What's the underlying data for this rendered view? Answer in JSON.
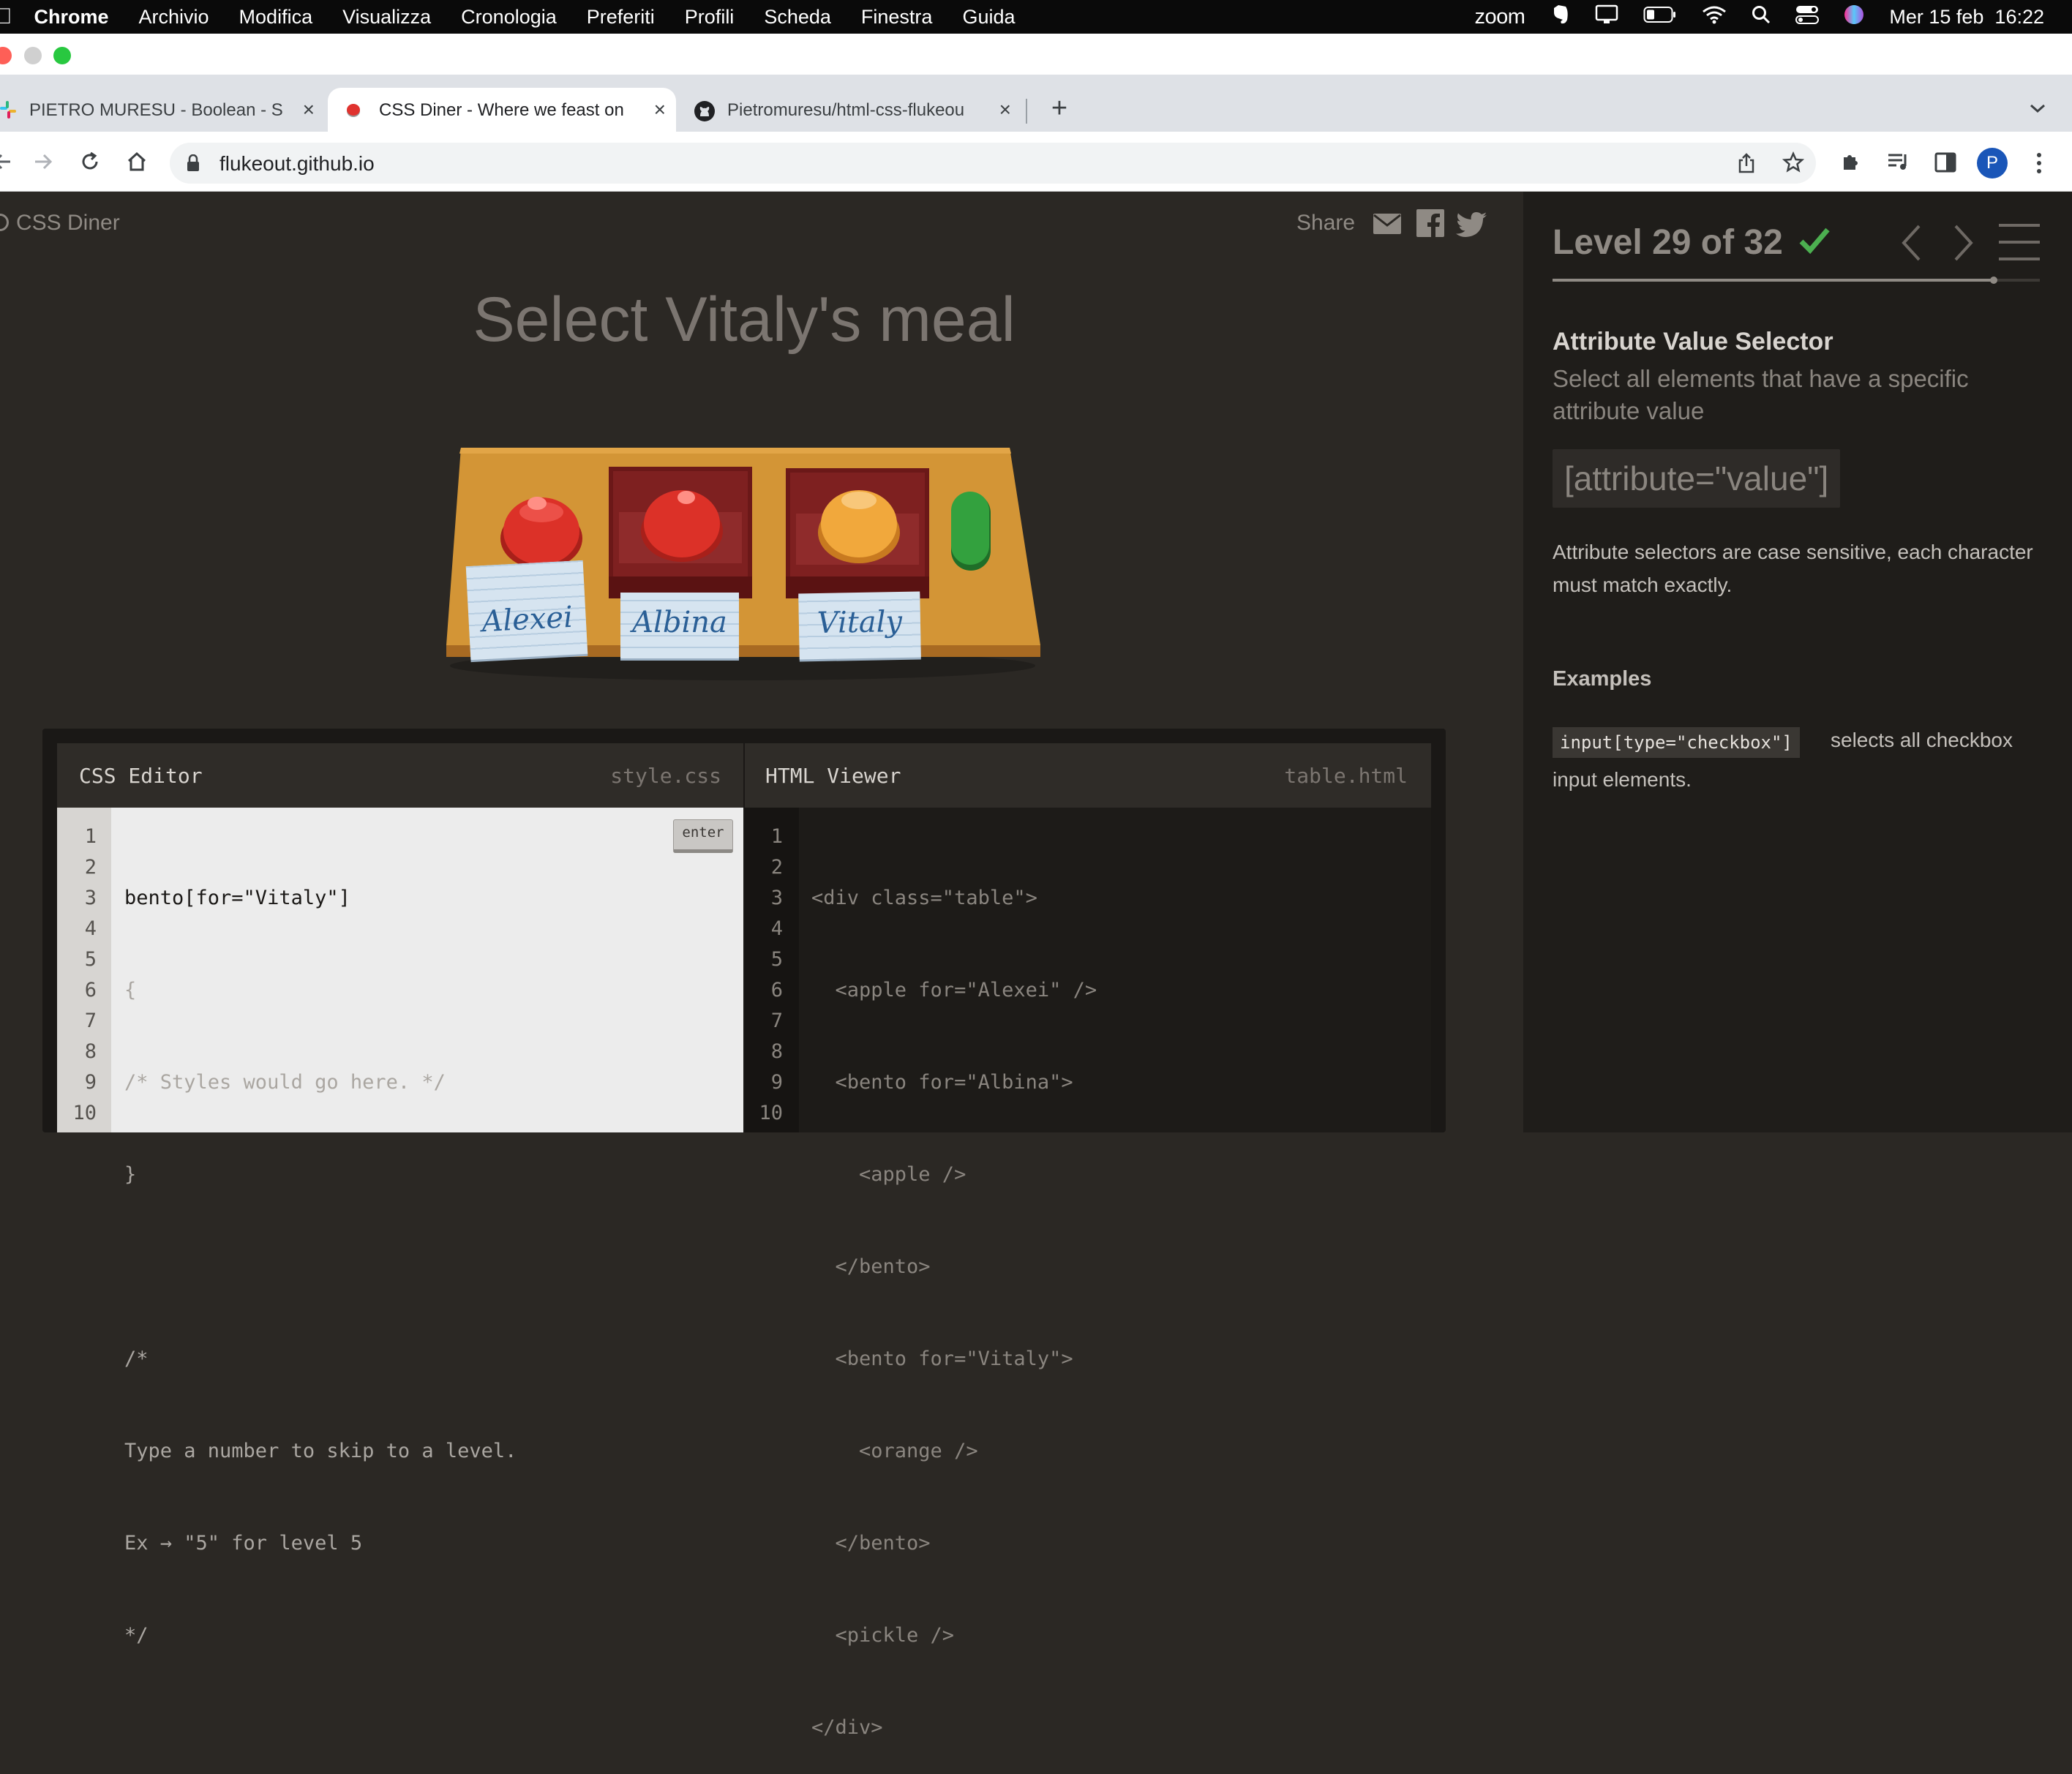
{
  "menubar": {
    "app": "Chrome",
    "items": [
      "Archivio",
      "Modifica",
      "Visualizza",
      "Cronologia",
      "Preferiti",
      "Profili",
      "Scheda",
      "Finestra",
      "Guida"
    ],
    "zoom": "zoom",
    "datetime": "Mer 15 feb  16:22"
  },
  "tabs": [
    {
      "title": "PIETRO MURESU - Boolean - S"
    },
    {
      "title": "CSS Diner - Where we feast on"
    },
    {
      "title": "Pietromuresu/html-css-flukeou"
    }
  ],
  "address": {
    "url": "flukeout.github.io"
  },
  "profile": {
    "initial": "P"
  },
  "game": {
    "brand": "CSS Diner",
    "share_label": "Share",
    "instruction": "Select Vitaly's meal",
    "plates": [
      "Alexei",
      "Albina",
      "Vitaly"
    ]
  },
  "css_editor": {
    "title": "CSS Editor",
    "file": "style.css",
    "enter_label": "enter",
    "line_numbers": [
      "1",
      "2",
      "3",
      "4",
      "5",
      "6",
      "7",
      "8",
      "9",
      "10"
    ],
    "input": "bento[for=\"Vitaly\"]",
    "lines": [
      "{",
      "/* Styles would go here. */",
      "}",
      "",
      "/*",
      "Type a number to skip to a level.",
      "Ex → \"5\" for level 5",
      "*/"
    ]
  },
  "html_viewer": {
    "title": "HTML Viewer",
    "file": "table.html",
    "line_numbers": [
      "1",
      "2",
      "3",
      "4",
      "5",
      "6",
      "7",
      "8",
      "9",
      "10"
    ],
    "lines": [
      "<div class=\"table\">",
      "  <apple for=\"Alexei\" />",
      "  <bento for=\"Albina\">",
      "    <apple />",
      "  </bento>",
      "  <bento for=\"Vitaly\">",
      "    <orange />",
      "  </bento>",
      "  <pickle />",
      "</div>"
    ]
  },
  "level": {
    "title": "Level 29 of 32",
    "progress": 0.906,
    "selector_name": "Attribute Value Selector",
    "summary": "Select all elements that have a specific attribute value",
    "syntax": "[attribute=\"value\"]",
    "description": "Attribute selectors are case sensitive, each character must match exactly.",
    "examples_title": "Examples",
    "example_code": "input[type=\"checkbox\"]",
    "example_text_1": "selects all checkbox",
    "example_text_2": "input elements."
  },
  "colors": {
    "page_bg": "#2b2824",
    "sidebar_bg": "#1f1d1a",
    "check": "#4caf50",
    "editor_bg": "#ececec",
    "viewer_bg": "#1d1b18"
  }
}
